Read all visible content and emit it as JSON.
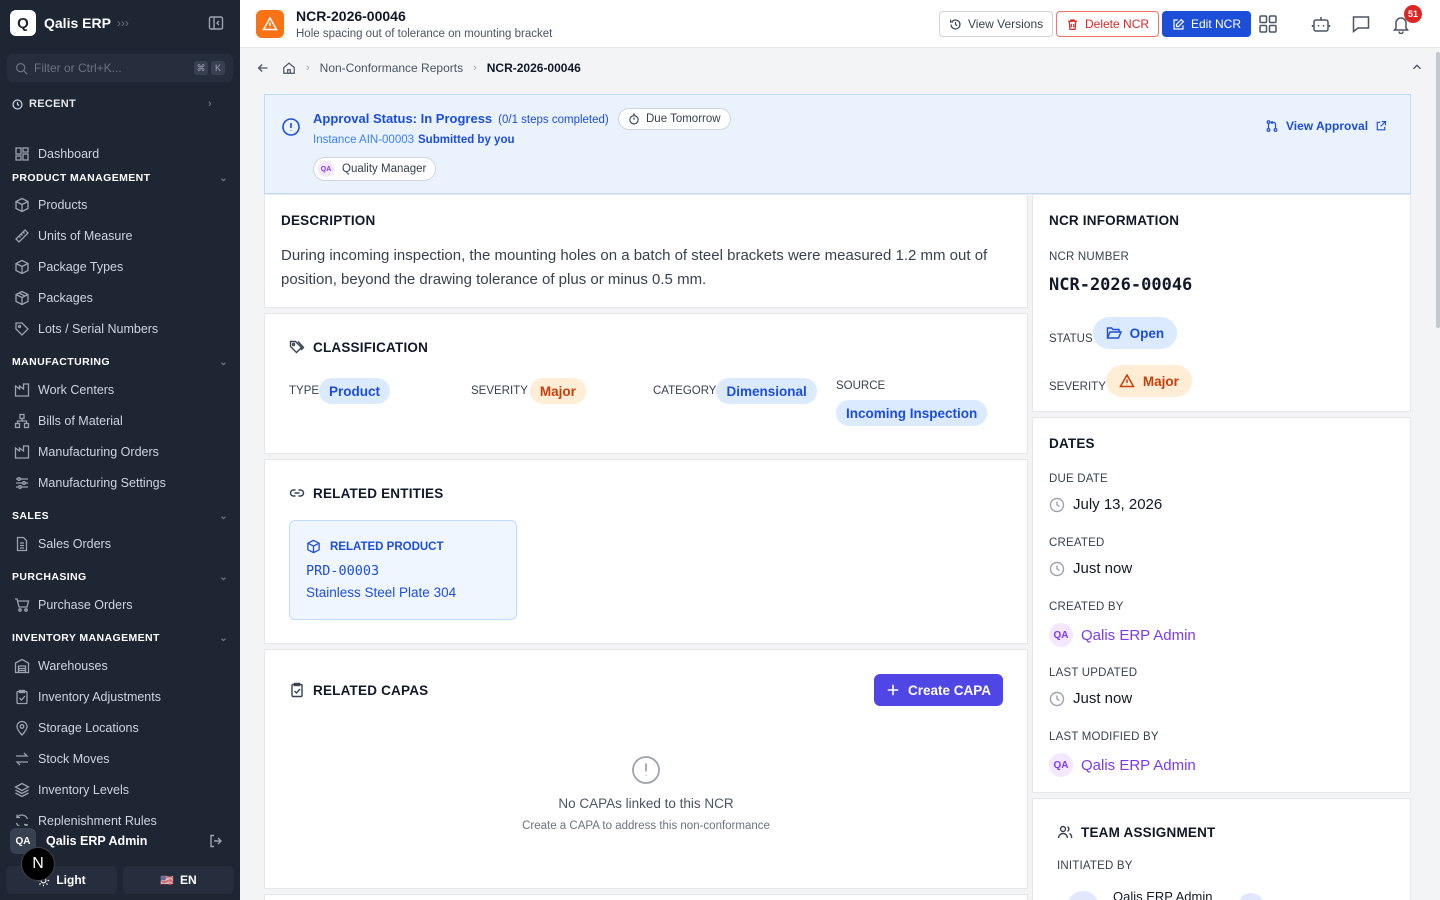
{
  "brand": {
    "name": "Qalis ERP",
    "logo_letter": "Q"
  },
  "sidebar": {
    "search_placeholder": "Filter or Ctrl+K...",
    "kbd": [
      "⌘",
      "K"
    ],
    "recent_label": "RECENT",
    "dashboard": "Dashboard",
    "sections": [
      {
        "title": "PRODUCT MANAGEMENT",
        "items": [
          "Products",
          "Units of Measure",
          "Package Types",
          "Packages",
          "Lots / Serial Numbers"
        ]
      },
      {
        "title": "MANUFACTURING",
        "items": [
          "Work Centers",
          "Bills of Material",
          "Manufacturing Orders",
          "Manufacturing Settings"
        ]
      },
      {
        "title": "SALES",
        "items": [
          "Sales Orders"
        ]
      },
      {
        "title": "PURCHASING",
        "items": [
          "Purchase Orders"
        ]
      },
      {
        "title": "INVENTORY MANAGEMENT",
        "items": [
          "Warehouses",
          "Inventory Adjustments",
          "Storage Locations",
          "Stock Moves",
          "Inventory Levels",
          "Replenishment Rules"
        ]
      }
    ],
    "user": {
      "initials": "QA",
      "name": "Qalis ERP Admin"
    },
    "theme_label": "Light",
    "lang_label": "EN",
    "lang_flag": "🇺🇸",
    "next_badge": "N"
  },
  "topbar": {
    "title": "NCR-2026-00046",
    "subtitle": "Hole spacing out of tolerance on mounting bracket",
    "view_versions": "View Versions",
    "delete": "Delete NCR",
    "edit": "Edit NCR",
    "notifications": "51"
  },
  "breadcrumb": {
    "section": "Non-Conformance Reports",
    "current": "NCR-2026-00046"
  },
  "approval": {
    "title": "Approval Status: In Progress",
    "steps": "(0/1 steps completed)",
    "due": "Due Tomorrow",
    "instance": "Instance AIN-00003",
    "submitted": "Submitted by you",
    "role_initials": "QA",
    "role": "Quality Manager",
    "view": "View Approval"
  },
  "description": {
    "heading": "DESCRIPTION",
    "text": "During incoming inspection, the mounting holes on a batch of steel brackets were measured 1.2 mm out of position, beyond the drawing tolerance of plus or minus 0.5 mm."
  },
  "classification": {
    "heading": "CLASSIFICATION",
    "type_label": "TYPE",
    "type": "Product",
    "severity_label": "SEVERITY",
    "severity": "Major",
    "category_label": "CATEGORY",
    "category": "Dimensional",
    "source_label": "SOURCE",
    "source": "Incoming Inspection"
  },
  "related_entities": {
    "heading": "RELATED ENTITIES",
    "label": "RELATED PRODUCT",
    "code": "PRD-00003",
    "name": "Stainless Steel Plate 304"
  },
  "capas": {
    "heading": "RELATED CAPAS",
    "create": "Create CAPA",
    "empty_title": "No CAPAs linked to this NCR",
    "empty_sub": "Create a CAPA to address this non-conformance"
  },
  "ncr_info": {
    "heading": "NCR INFORMATION",
    "number_label": "NCR NUMBER",
    "number": "NCR-2026-00046",
    "status_label": "STATUS",
    "status": "Open",
    "severity_label": "SEVERITY",
    "severity": "Major"
  },
  "dates": {
    "heading": "DATES",
    "due_label": "DUE DATE",
    "due": "July 13, 2026",
    "created_label": "CREATED",
    "created": "Just now",
    "created_by_label": "CREATED BY",
    "created_by": "Qalis ERP Admin",
    "updated_label": "LAST UPDATED",
    "updated": "Just now",
    "modified_by_label": "LAST MODIFIED BY",
    "modified_by": "Qalis ERP Admin",
    "initials": "QA"
  },
  "team": {
    "heading": "TEAM ASSIGNMENT",
    "initiated_label": "INITIATED BY",
    "initiated_by": "Qalis ERP Admin"
  },
  "colors": {
    "sidebar_bg": "#1e2533",
    "primary": "#1d4ed8",
    "danger": "#dc2626",
    "accent_orange": "#f97316",
    "capa_button": "#4f46e5"
  }
}
